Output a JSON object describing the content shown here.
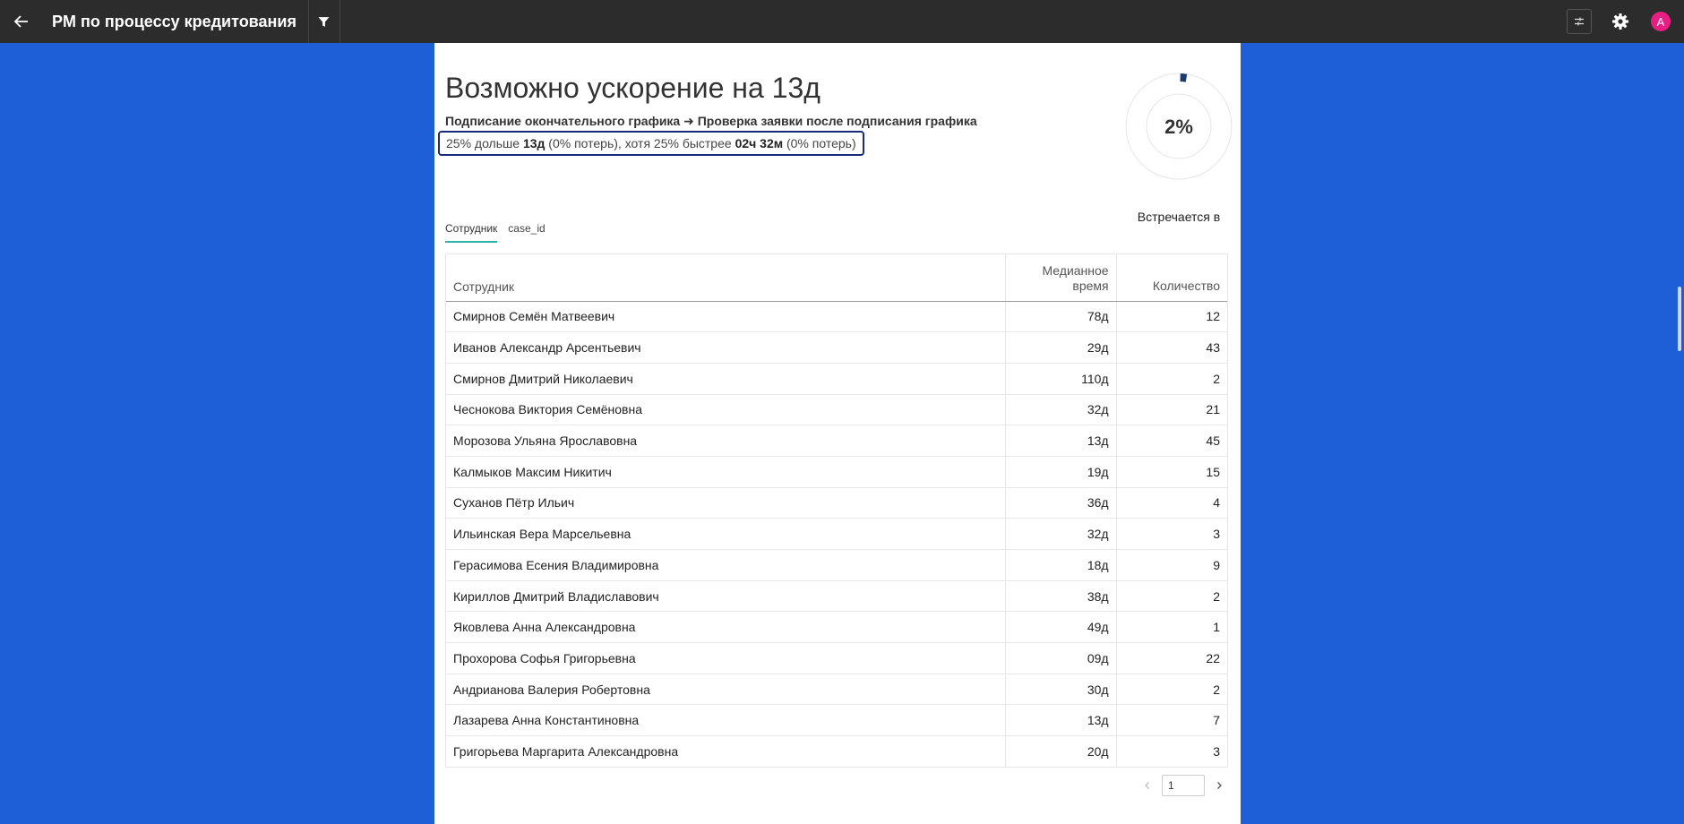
{
  "header": {
    "title": "PM по процессу кредитования",
    "avatar_letter": "A"
  },
  "insight": {
    "headline": "Возможно ускорение на 13д",
    "transition": "Подписание окончательного графика ➜ Проверка заявки после подписания графика",
    "stats": {
      "part1": "25% дольше ",
      "slow_value": "13д",
      "part2": " (0% потерь), хотя 25% быстрее ",
      "fast_value": "02ч 32м",
      "part3": " (0% потерь)"
    },
    "occurrence": {
      "percent_label": "2%",
      "percent": 2,
      "caption": "Встречается в"
    }
  },
  "tabs": [
    {
      "label": "Сотрудник",
      "active": true
    },
    {
      "label": "case_id",
      "active": false
    }
  ],
  "table": {
    "columns": {
      "name": "Сотрудник",
      "median": "Медианное время",
      "count": "Количество"
    },
    "rows": [
      {
        "name": "Смирнов Семён Матвеевич",
        "median": "78д",
        "count": "12"
      },
      {
        "name": "Иванов Александр Арсентьевич",
        "median": "29д",
        "count": "43"
      },
      {
        "name": "Смирнов Дмитрий Николаевич",
        "median": "110д",
        "count": "2"
      },
      {
        "name": "Чеснокова Виктория Семёновна",
        "median": "32д",
        "count": "21"
      },
      {
        "name": "Морозова Ульяна Ярославовна",
        "median": "13д",
        "count": "45"
      },
      {
        "name": "Калмыков Максим Никитич",
        "median": "19д",
        "count": "15"
      },
      {
        "name": "Суханов Пётр Ильич",
        "median": "36д",
        "count": "4"
      },
      {
        "name": "Ильинская Вера Марсельевна",
        "median": "32д",
        "count": "3"
      },
      {
        "name": "Герасимова Есения Владимировна",
        "median": "18д",
        "count": "9"
      },
      {
        "name": "Кириллов Дмитрий Владиславович",
        "median": "38д",
        "count": "2"
      },
      {
        "name": "Яковлева Анна Александровна",
        "median": "49д",
        "count": "1"
      },
      {
        "name": "Прохорова Софья Григорьевна",
        "median": "09д",
        "count": "22"
      },
      {
        "name": "Андрианова Валерия Робертовна",
        "median": "30д",
        "count": "2"
      },
      {
        "name": "Лазарева Анна Константиновна",
        "median": "13д",
        "count": "7"
      },
      {
        "name": "Григорьева Маргарита Александровна",
        "median": "20д",
        "count": "3"
      }
    ]
  },
  "pagination": {
    "current_page": "1"
  },
  "colors": {
    "background": "#1e5ed6",
    "topbar": "#2c2c2c",
    "tab_accent": "#2bb3a3",
    "donut_fill": "#1f3a6e",
    "avatar": "#e91e84",
    "highlight_border": "#1a2a7a"
  },
  "icons": {
    "back": "arrow-left-icon",
    "filter": "funnel-icon",
    "sliders": "sliders-icon",
    "settings": "gear-icon",
    "prev": "chevron-left-icon",
    "next": "chevron-right-icon"
  }
}
